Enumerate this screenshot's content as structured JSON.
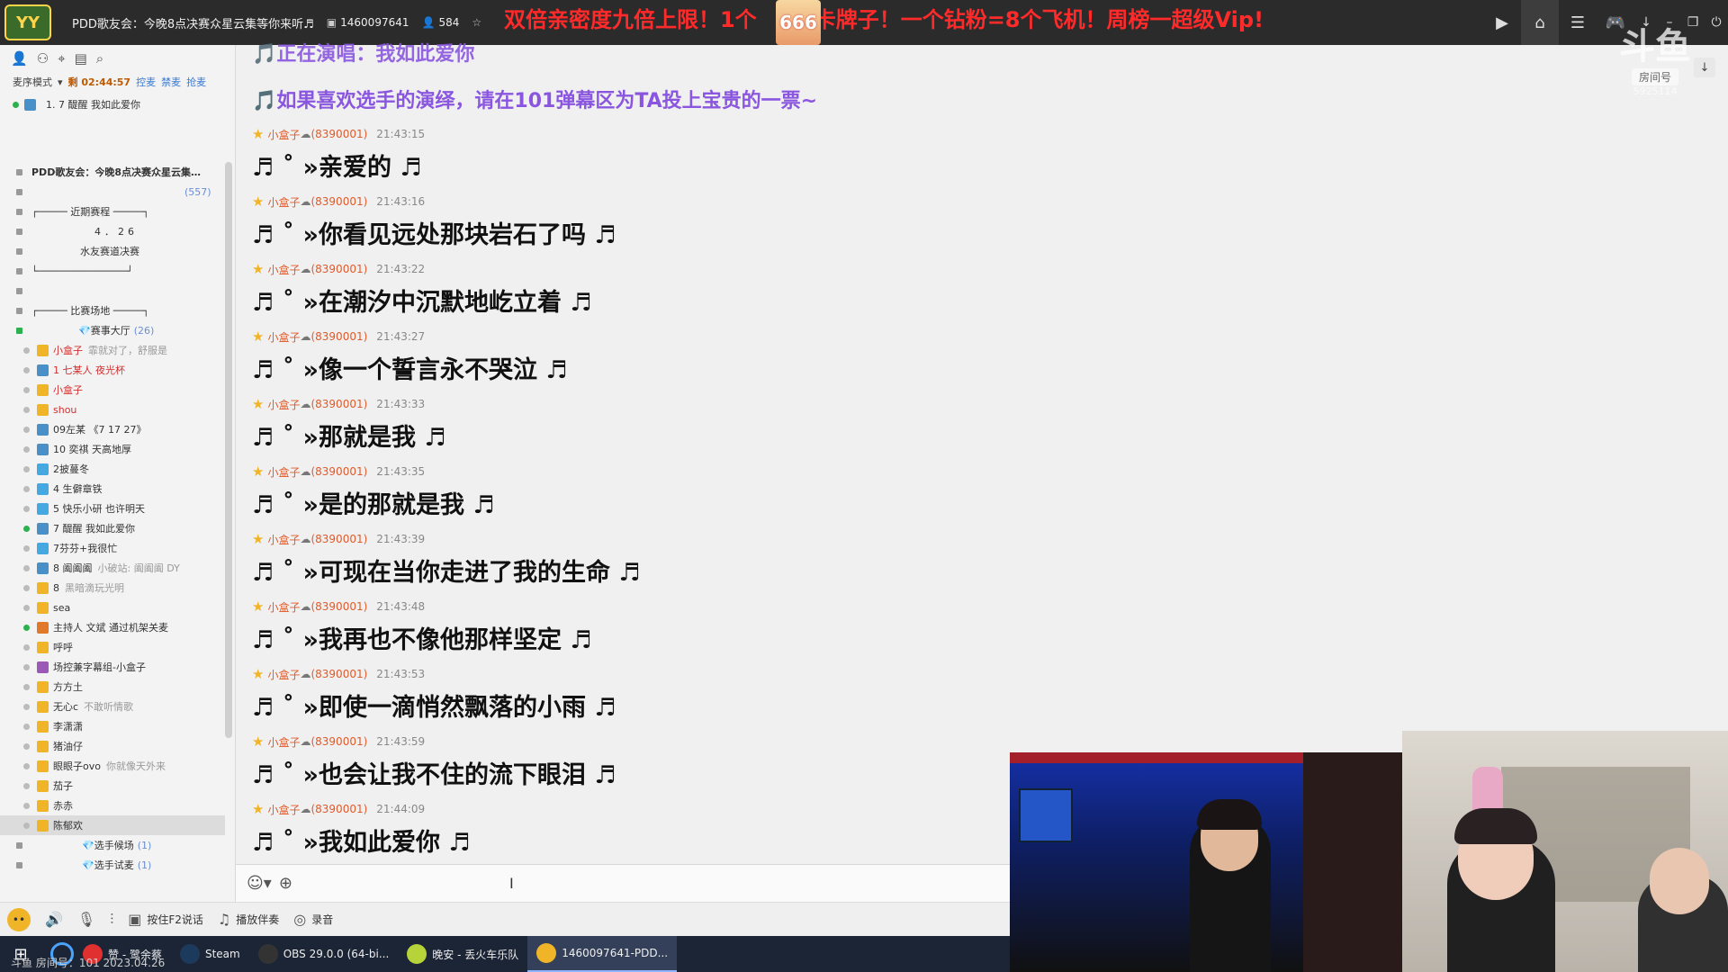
{
  "topbar": {
    "room_title": "PDD歌友会：今晚8点决赛众星云集等你来听♬",
    "room_id": "1460097641",
    "online_count": "584",
    "marquee": "双倍亲密度九倍上限！1个",
    "marquee2": "卡牌子！一个钻粉=8个飞机！周榜一超级Vip!",
    "badge": "666"
  },
  "left": {
    "mode_label": "麦序模式",
    "timer": "剩 02:44:57",
    "links": [
      "控麦",
      "禁麦",
      "抢麦"
    ],
    "queue_item": "1.  7 醍醒 我如此爱你",
    "tree": [
      {
        "text": "PDD歌友会：今晚8点决赛众星云集…",
        "kind": "root"
      },
      {
        "text": "(557)",
        "kind": "count"
      },
      {
        "text": "┌───── 近期赛程 ─────┐",
        "kind": "plain"
      },
      {
        "text": "4．26",
        "kind": "plain"
      },
      {
        "text": "水友赛道决赛",
        "kind": "plain"
      },
      {
        "text": "└───────────────┘",
        "kind": "plain"
      },
      {
        "text": "",
        "kind": "plain"
      },
      {
        "text": "┌───── 比赛场地 ─────┐",
        "kind": "plain"
      },
      {
        "text": "赛事大厅",
        "count": "(26)",
        "kind": "hall"
      }
    ],
    "members": [
      {
        "name": "小盒子",
        "extra": "霏就对了，舒服是",
        "color": "red",
        "icon": "y"
      },
      {
        "name": "1 七某人 夜光杯",
        "extra": "",
        "color": "red",
        "icon": "b"
      },
      {
        "name": "小盒子",
        "extra": "",
        "color": "red",
        "icon": "y"
      },
      {
        "name": "shou",
        "extra": "",
        "color": "red",
        "icon": "y"
      },
      {
        "name": "09左某 《7 17 27》",
        "extra": "",
        "color": "",
        "icon": "b"
      },
      {
        "name": "10 奕祺 天高地厚",
        "extra": "",
        "color": "",
        "icon": "b"
      },
      {
        "name": "2披蔓冬",
        "extra": "",
        "color": "",
        "icon": "c"
      },
      {
        "name": "4 生僻章铁",
        "extra": "",
        "color": "",
        "icon": "c"
      },
      {
        "name": "5 快乐小研 也许明天",
        "extra": "",
        "color": "",
        "icon": "c"
      },
      {
        "name": "7 醍醒 我如此爱你",
        "extra": "",
        "color": "",
        "icon": "b"
      },
      {
        "name": "7芬芬+我很忙",
        "extra": "",
        "color": "",
        "icon": "c"
      },
      {
        "name": "8 阖阖阖",
        "extra": "小破站: 阖阖阖 DY",
        "color": "",
        "icon": "b"
      },
      {
        "name": "8",
        "extra": "黑暗滴玩光明",
        "color": "",
        "icon": "y"
      },
      {
        "name": "sea",
        "extra": "",
        "color": "",
        "icon": "y"
      },
      {
        "name": "主持人 文斌 通过机架关麦",
        "extra": "",
        "color": "",
        "icon": "o"
      },
      {
        "name": "呼呼",
        "extra": "",
        "color": "",
        "icon": "y"
      },
      {
        "name": "场控兼字幕组-小盒子",
        "extra": "",
        "color": "",
        "icon": "p"
      },
      {
        "name": "方方土",
        "extra": "",
        "color": "",
        "icon": "y"
      },
      {
        "name": "无心c",
        "extra": "不敢听情歌",
        "color": "",
        "icon": "y"
      },
      {
        "name": "李潇潇",
        "extra": "",
        "color": "",
        "icon": "y"
      },
      {
        "name": "猪油仔",
        "extra": "",
        "color": "",
        "icon": "y"
      },
      {
        "name": "眼眼子ovo",
        "extra": "你就像天外来",
        "color": "",
        "icon": "y"
      },
      {
        "name": "茄子",
        "extra": "",
        "color": "",
        "icon": "y"
      },
      {
        "name": "赤赤",
        "extra": "",
        "color": "",
        "icon": "y"
      },
      {
        "name": "陈郁欢",
        "extra": "",
        "color": "",
        "icon": "y"
      }
    ],
    "sub_channels": [
      {
        "text": "选手候场",
        "count": "(1)"
      },
      {
        "text": "选手试麦",
        "count": "(1)"
      }
    ]
  },
  "chat": {
    "top_msg_cut": "正在演唱：我如此爱你",
    "top_msg": "如果喜欢选手的演绎，请在101弹幕区为TA投上宝贵的一票~",
    "messages": [
      {
        "name": "小盒子",
        "id": "(8390001)",
        "time": "21:43:15",
        "text": "♬ ˚ »亲爱的 ♬"
      },
      {
        "name": "小盒子",
        "id": "(8390001)",
        "time": "21:43:16",
        "text": "♬ ˚ »你看见远处那块岩石了吗 ♬"
      },
      {
        "name": "小盒子",
        "id": "(8390001)",
        "time": "21:43:22",
        "text": "♬ ˚ »在潮汐中沉默地屹立着 ♬"
      },
      {
        "name": "小盒子",
        "id": "(8390001)",
        "time": "21:43:27",
        "text": "♬ ˚ »像一个誓言永不哭泣 ♬"
      },
      {
        "name": "小盒子",
        "id": "(8390001)",
        "time": "21:43:33",
        "text": "♬ ˚ »那就是我 ♬"
      },
      {
        "name": "小盒子",
        "id": "(8390001)",
        "time": "21:43:35",
        "text": "♬ ˚ »是的那就是我 ♬"
      },
      {
        "name": "小盒子",
        "id": "(8390001)",
        "time": "21:43:39",
        "text": "♬ ˚ »可现在当你走进了我的生命 ♬"
      },
      {
        "name": "小盒子",
        "id": "(8390001)",
        "time": "21:43:48",
        "text": "♬ ˚ »我再也不像他那样坚定 ♬"
      },
      {
        "name": "小盒子",
        "id": "(8390001)",
        "time": "21:43:53",
        "text": "♬ ˚ »即使一滴悄然飘落的小雨 ♬"
      },
      {
        "name": "小盒子",
        "id": "(8390001)",
        "time": "21:43:59",
        "text": "♬ ˚ »也会让我不住的流下眼泪 ♬"
      },
      {
        "name": "小盒子",
        "id": "(8390001)",
        "time": "21:44:09",
        "text": "♬ ˚ »我如此爱你 ♬"
      }
    ]
  },
  "bottombar": {
    "ptt": "按住F2说话",
    "accompany": "播放伴奏",
    "record": "录音"
  },
  "watermark": {
    "logo": "斗鱼",
    "label": "房间号",
    "room": "5925114"
  },
  "taskbar": {
    "items": [
      "赞 - 鹭余蔡",
      "Steam",
      "OBS 29.0.0 (64-bi...",
      "晚安 - 丢火车乐队",
      "1460097641-PDD..."
    ],
    "overlay": "斗鱼 房间号：101  2023.04.26"
  }
}
